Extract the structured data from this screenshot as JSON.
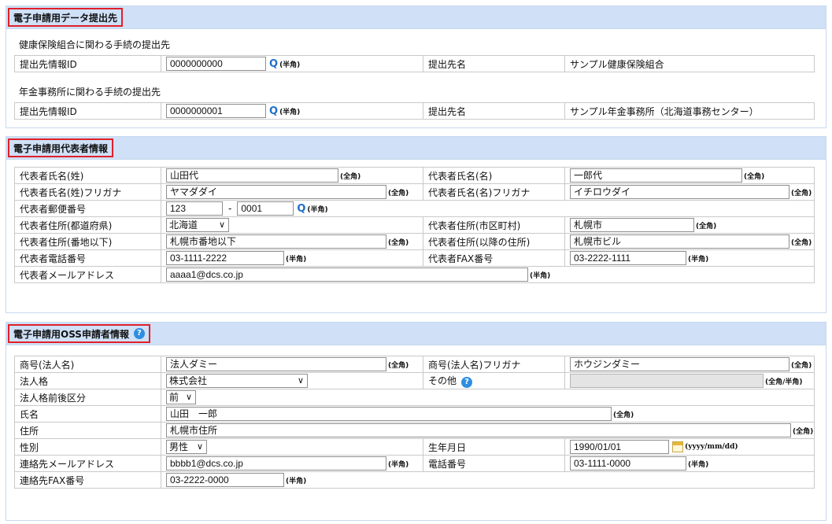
{
  "section1": {
    "title": "電子申請用データ提出先",
    "health_sub": "健康保険組合に関わる手続の提出先",
    "pension_sub": "年金事務所に関わる手続の提出先",
    "rows": [
      {
        "id_label": "提出先情報ID",
        "id_value": "0000000000",
        "hw": "(半角)",
        "name_label": "提出先名",
        "name_value": "サンプル健康保険組合"
      },
      {
        "id_label": "提出先情報ID",
        "id_value": "0000000001",
        "hw": "(半角)",
        "name_label": "提出先名",
        "name_value": "サンプル年金事務所（北海道事務センター）"
      }
    ]
  },
  "section2": {
    "title": "電子申請用代表者情報",
    "last_name_label": "代表者氏名(姓)",
    "last_name": "山田代",
    "first_name_label": "代表者氏名(名)",
    "first_name": "一郎代",
    "last_kana_label": "代表者氏名(姓)フリガナ",
    "last_kana": "ヤマダダイ",
    "first_kana_label": "代表者氏名(名)フリガナ",
    "first_kana": "イチロウダイ",
    "zip_label": "代表者郵便番号",
    "zip1": "123",
    "zip_dash": "-",
    "zip2": "0001",
    "pref_label": "代表者住所(都道府県)",
    "pref": "北海道",
    "city_label": "代表者住所(市区町村)",
    "city": "札幌市",
    "addr_label": "代表者住所(番地以下)",
    "addr": "札幌市番地以下",
    "addr2_label": "代表者住所(以降の住所)",
    "addr2": "札幌市ビル",
    "tel_label": "代表者電話番号",
    "tel": "03-1111-2222",
    "fax_label": "代表者FAX番号",
    "fax": "03-2222-1111",
    "mail_label": "代表者メールアドレス",
    "mail": "aaaa1@dcs.co.jp"
  },
  "section3": {
    "title": "電子申請用OSS申請者情報",
    "corp_label": "商号(法人名)",
    "corp": "法人ダミー",
    "corp_kana_label": "商号(法人名)フリガナ",
    "corp_kana": "ホウジンダミー",
    "type_label": "法人格",
    "type": "株式会社",
    "other_label": "その他",
    "other": "",
    "pos_label": "法人格前後区分",
    "pos": "前",
    "name_label": "氏名",
    "name": "山田　一郎",
    "addr_label": "住所",
    "addr": "札幌市住所",
    "sex_label": "性別",
    "sex": "男性",
    "birth_label": "生年月日",
    "birth": "1990/01/01",
    "date_fmt": "(yyyy/mm/dd)",
    "mail_label": "連絡先メールアドレス",
    "mail": "bbbb1@dcs.co.jp",
    "tel_label": "電話番号",
    "tel": "03-1111-0000",
    "fax_label": "連絡先FAX番号",
    "fax": "03-2222-0000"
  },
  "notes": {
    "full": "(全角)",
    "half": "(半角)",
    "both": "(全角/半角)",
    "help": "?",
    "search": "Q",
    "chev": "∨"
  }
}
